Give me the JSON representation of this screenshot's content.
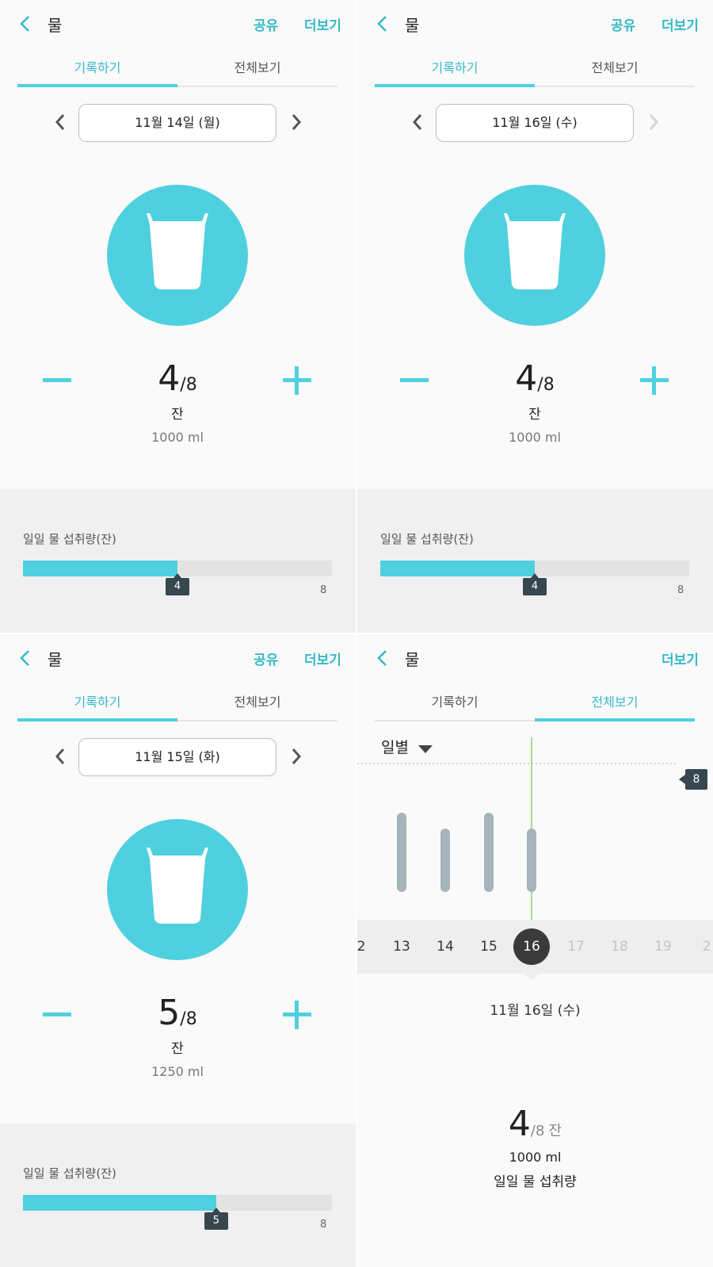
{
  "colors": {
    "accent": "#4fd0de",
    "accent_text": "#35b9c8",
    "badge": "#37474f"
  },
  "panels": {
    "p1": {
      "title": "물",
      "share": "공유",
      "more": "더보기",
      "tabs": [
        "기록하기",
        "전체보기"
      ],
      "date": "11월 14일 (월)",
      "count": "4",
      "goal": "/8",
      "unit": "잔",
      "ml": "1000 ml",
      "daily_label": "일일 물 섭취량(잔)",
      "progress": 0.5,
      "progress_value": "4",
      "progress_max": "8",
      "next_enabled": true
    },
    "p2": {
      "title": "물",
      "share": "공유",
      "more": "더보기",
      "tabs": [
        "기록하기",
        "전체보기"
      ],
      "date": "11월 16일 (수)",
      "count": "4",
      "goal": "/8",
      "unit": "잔",
      "ml": "1000 ml",
      "daily_label": "일일 물 섭취량(잔)",
      "progress": 0.5,
      "progress_value": "4",
      "progress_max": "8",
      "next_enabled": false
    },
    "p3": {
      "title": "물",
      "share": "공유",
      "more": "더보기",
      "tabs": [
        "기록하기",
        "전체보기"
      ],
      "date": "11월 15일 (화)",
      "count": "5",
      "goal": "/8",
      "unit": "잔",
      "ml": "1250 ml",
      "daily_label": "일일 물 섭취량(잔)",
      "progress": 0.625,
      "progress_value": "5",
      "progress_max": "8",
      "next_enabled": true
    },
    "p4": {
      "title": "물",
      "more": "더보기",
      "tabs": [
        "기록하기",
        "전체보기"
      ],
      "filter": "일별",
      "goal_badge": "8",
      "days": [
        "2",
        "13",
        "14",
        "15",
        "16",
        "17",
        "18",
        "19",
        "2"
      ],
      "selected_day": "16",
      "selected_date": "11월 16일 (수)",
      "count": "4",
      "goal": "/8",
      "unit": "잔",
      "ml": "1000 ml",
      "daily_label": "일일 물 섭취량"
    }
  },
  "chart_data": {
    "type": "bar",
    "categories": [
      "13",
      "14",
      "15",
      "16"
    ],
    "values": [
      5,
      4,
      5,
      4
    ],
    "ylim": [
      0,
      8
    ],
    "goal_line": 8,
    "grid": false
  }
}
